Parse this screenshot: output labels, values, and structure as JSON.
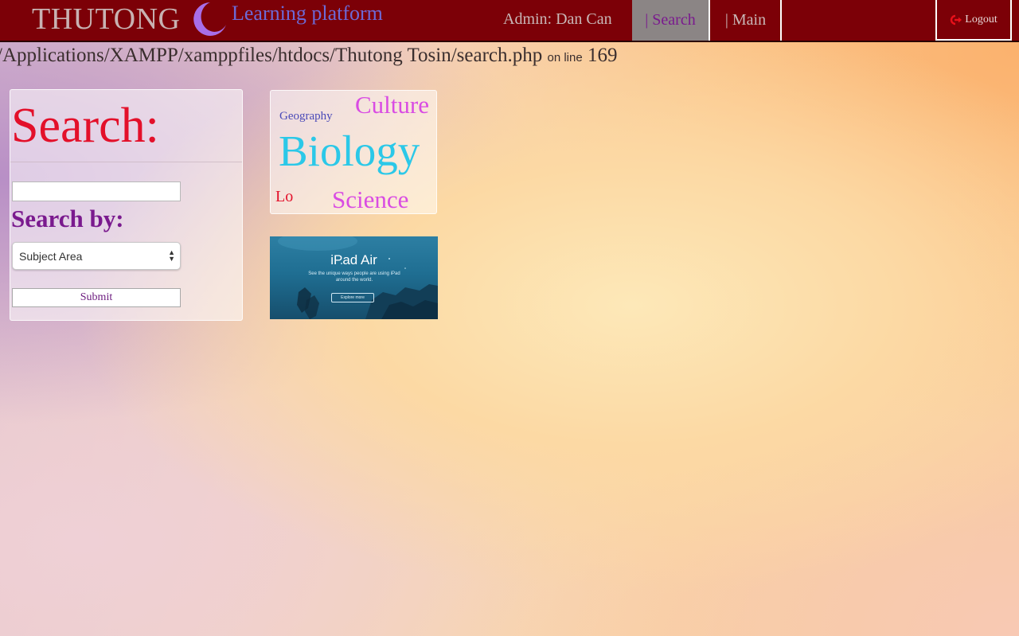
{
  "header": {
    "brand": "THUTONG",
    "subtitle": "Learning platform",
    "admin_label": "Admin: Dan Can",
    "nav": {
      "search": "| Search",
      "main": "| Main"
    },
    "logout": "Logout",
    "colors": {
      "bar": "#7c0007",
      "active_tab": "#8b8585"
    }
  },
  "error_line": {
    "path": "/Applications/XAMPP/xamppfiles/htdocs/Thutong Tosin/search.php",
    "on_line": "on line",
    "line_number": "169"
  },
  "search_panel": {
    "title": "Search:",
    "search_value": "",
    "search_by_label": "Search by:",
    "select_value": "Subject Area",
    "submit_label": "Submit"
  },
  "word_cloud": {
    "words": [
      "Geography",
      "Culture",
      "Biology",
      "Lo",
      "Science"
    ]
  },
  "ad": {
    "title": "iPad Air",
    "tagline": "See the unique ways people are using iPad around the world.",
    "cta": "Explore more"
  }
}
